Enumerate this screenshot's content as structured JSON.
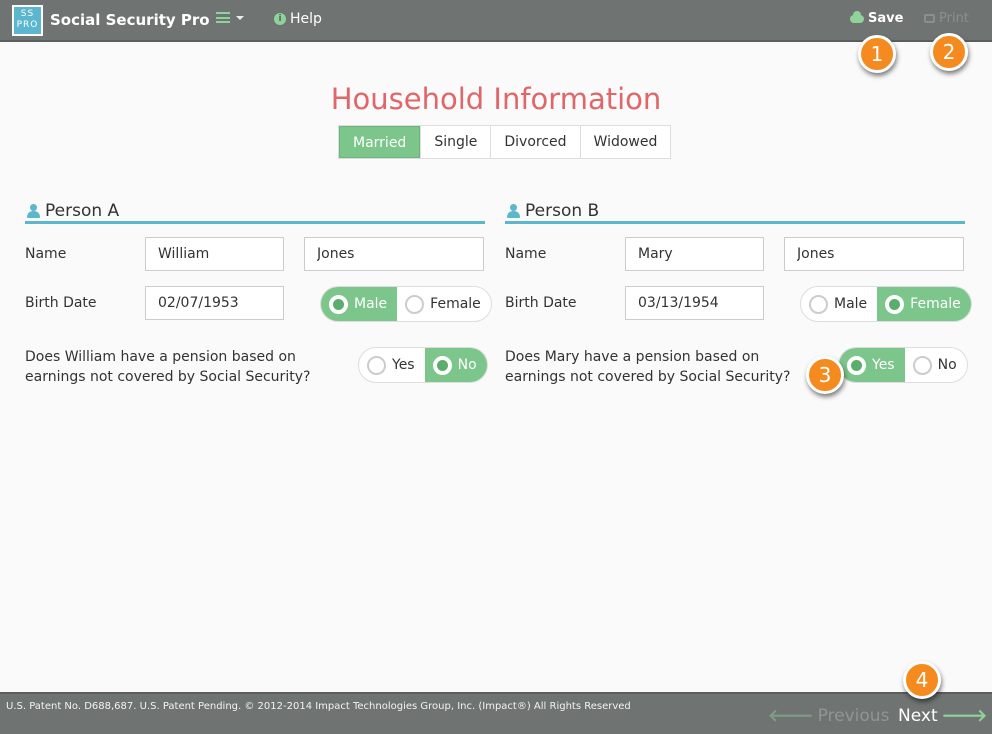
{
  "app": {
    "logo_text_top": "SS",
    "logo_text_bottom": "PRO",
    "title": "Social Security Pro",
    "help_label": "Help",
    "save_label": "Save",
    "print_label": "Print"
  },
  "callouts": [
    "1",
    "2",
    "3",
    "4"
  ],
  "page": {
    "title": "Household Information",
    "marital_status": {
      "selected": "Married",
      "options": [
        "Married",
        "Single",
        "Divorced",
        "Widowed"
      ]
    }
  },
  "person_a": {
    "header": "Person A",
    "name_label": "Name",
    "first_name": "William",
    "last_name": "Jones",
    "birth_label": "Birth Date",
    "birth_date": "02/07/1953",
    "gender_options": [
      "Male",
      "Female"
    ],
    "gender_selected": "Male",
    "pension_question": "Does William have a pension based on earnings not covered by Social Security?",
    "pension_options": [
      "Yes",
      "No"
    ],
    "pension_selected": "No"
  },
  "person_b": {
    "header": "Person B",
    "name_label": "Name",
    "first_name": "Mary",
    "last_name": "Jones",
    "birth_label": "Birth Date",
    "birth_date": "03/13/1954",
    "gender_options": [
      "Male",
      "Female"
    ],
    "gender_selected": "Female",
    "pension_question": "Does Mary have a pension based on earnings not covered by Social Security?",
    "pension_options": [
      "Yes",
      "No"
    ],
    "pension_selected": "Yes"
  },
  "footer": {
    "copyright": "U.S. Patent No. D688,687. U.S. Patent Pending. © 2012-2014 Impact Technologies Group, Inc. (Impact®) All Rights Reserved",
    "previous_label": "Previous",
    "next_label": "Next",
    "previous_arrow": "🡐",
    "next_arrow": "🡒"
  },
  "colors": {
    "accent_green": "#7cc58b",
    "title_red": "#e0666a",
    "section_blue": "#5bb7cd",
    "callout_orange": "#f58a1f",
    "bar_gray": "#6f7472"
  }
}
